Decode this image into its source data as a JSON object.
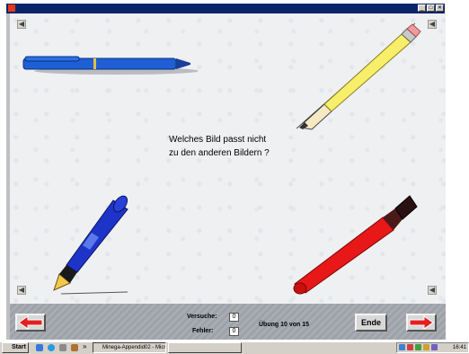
{
  "window": {
    "close_glyph": "✕",
    "max_glyph": "□",
    "min_glyph": "_"
  },
  "speaker_glyph": "◀",
  "question": {
    "line1": "Welches Bild passt nicht",
    "line2": "zu den anderen Bildern ?"
  },
  "items": [
    {
      "name": "ballpoint-pen",
      "color": "#1f5fd6"
    },
    {
      "name": "pencil",
      "color": "#f7ef6a"
    },
    {
      "name": "fountain-pen",
      "color": "#1e34c8"
    },
    {
      "name": "lipstick",
      "color": "#e81818"
    }
  ],
  "panel": {
    "versuche_label": "Versuche:",
    "versuche_value": "0",
    "fehler_label": "Fehler:",
    "fehler_value": "0",
    "progress": "Übung 10 von 15",
    "ende_label": "Ende",
    "arrow_color": "#e32020"
  },
  "taskbar": {
    "start_label": "Start",
    "chevron": "»",
    "task1_label": "Minega-Appendid02 - Micr...",
    "clock": "16:41"
  }
}
